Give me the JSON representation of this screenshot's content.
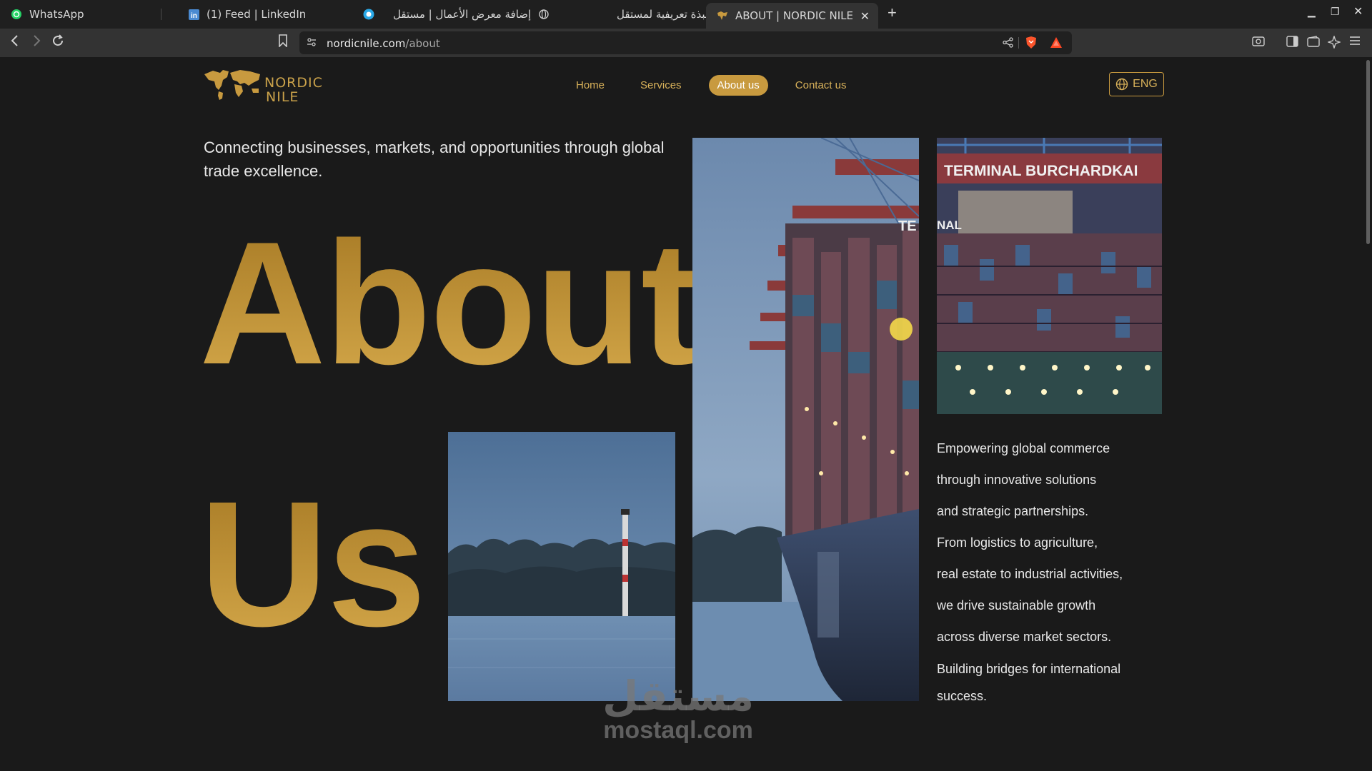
{
  "browser": {
    "tabs": [
      {
        "label": "WhatsApp",
        "icon": "whatsapp-icon"
      },
      {
        "label": "(1) Feed | LinkedIn",
        "icon": "linkedin-icon"
      },
      {
        "label": "إضافة معرض الأعمال | مستقل",
        "icon": "mostaql-icon"
      },
      {
        "label": "نبذة تعريفية لمستقل",
        "icon": "globe-icon"
      },
      {
        "label": "ABOUT | NORDIC NILE",
        "icon": "nordic-nile-icon"
      }
    ],
    "url_host": "nordicnile.com",
    "url_path": "/about"
  },
  "site": {
    "logo_line1": "NORDIC",
    "logo_line2": "NILE",
    "nav": [
      "Home",
      "Services",
      "About us",
      "Contact us"
    ],
    "active_nav": "About us",
    "lang": "ENG"
  },
  "hero": {
    "tagline": "Connecting businesses, markets, and opportunities through global trade excellence.",
    "title_line1": "About",
    "title_line2": "Us",
    "image_sign": "TERMINAL BURCHARDKAI",
    "body_lines": [
      "Empowering global commerce",
      "through innovative solutions",
      "and strategic partnerships.",
      "From logistics to agriculture,",
      "real estate to industrial activities,",
      "we drive sustainable growth",
      "across diverse market sectors.",
      "Building bridges for international",
      "success."
    ]
  },
  "watermark": {
    "arabic": "مستقل",
    "latin": "mostaql.com"
  },
  "colors": {
    "accent": "#c89a3f",
    "background": "#1a1a1a",
    "text": "#e8e8e8"
  }
}
